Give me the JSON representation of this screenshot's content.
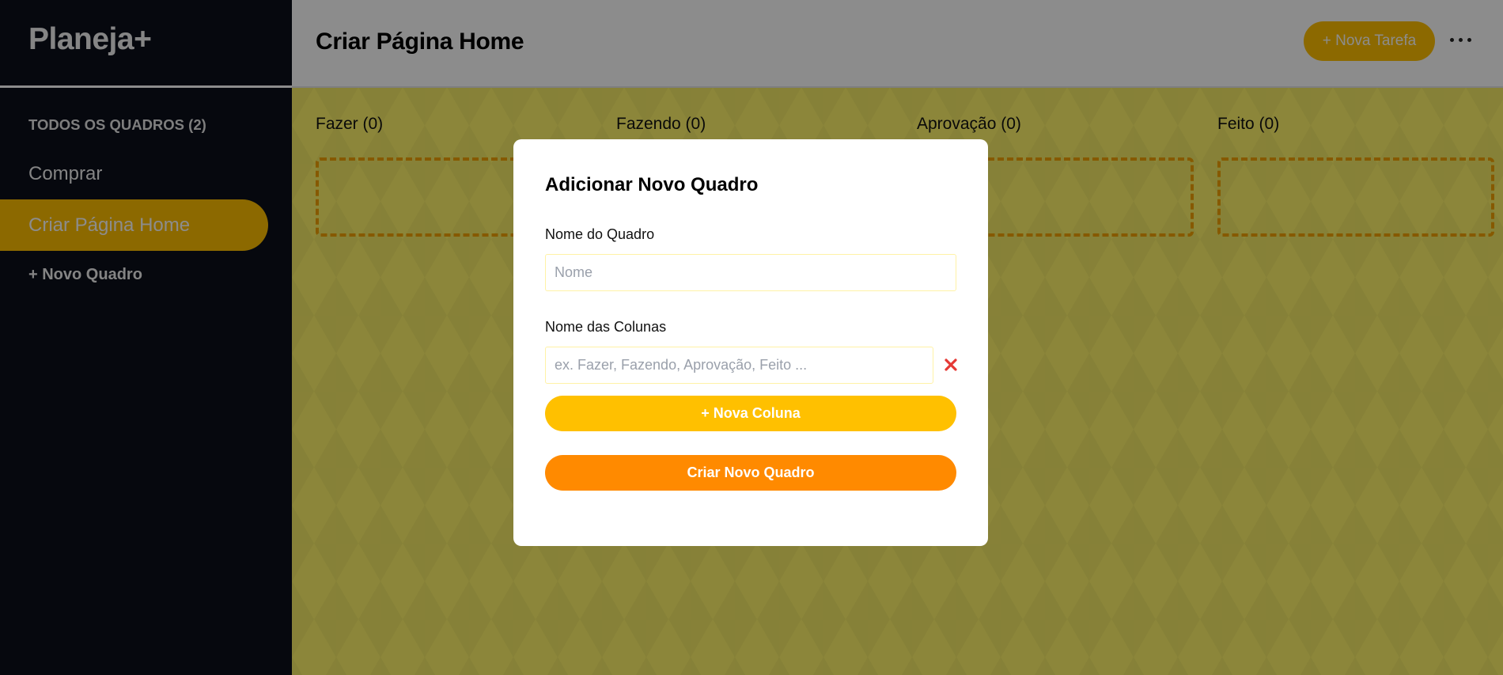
{
  "sidebar": {
    "logo": "Planeja+",
    "boards_heading": "TODOS OS QUADROS (2)",
    "boards": [
      {
        "label": "Comprar",
        "active": false
      },
      {
        "label": "Criar Página Home",
        "active": true
      }
    ],
    "new_board_label": "+ Novo Quadro"
  },
  "header": {
    "title": "Criar Página Home",
    "new_task_label": "+ Nova Tarefa",
    "more_icon": "ellipsis-horizontal-icon"
  },
  "board": {
    "columns": [
      {
        "title": "Fazer (0)"
      },
      {
        "title": "Fazendo (0)"
      },
      {
        "title": "Aprovação (0)"
      },
      {
        "title": "Feito (0)"
      }
    ]
  },
  "modal": {
    "title": "Adicionar Novo Quadro",
    "name_label": "Nome do Quadro",
    "name_value": "",
    "name_placeholder": "Nome",
    "columns_label": "Nome das Colunas",
    "column_value": "",
    "column_placeholder": "ex. Fazer, Fazendo, Aprovação, Feito ...",
    "remove_icon": "close-icon",
    "add_column_label": "+ Nova Coluna",
    "create_label": "Criar Novo Quadro"
  },
  "colors": {
    "accent_yellow": "#ffc000",
    "accent_orange": "#ff8a00",
    "sidebar_bg": "#0b0f1a",
    "remove_red": "#e53935"
  }
}
